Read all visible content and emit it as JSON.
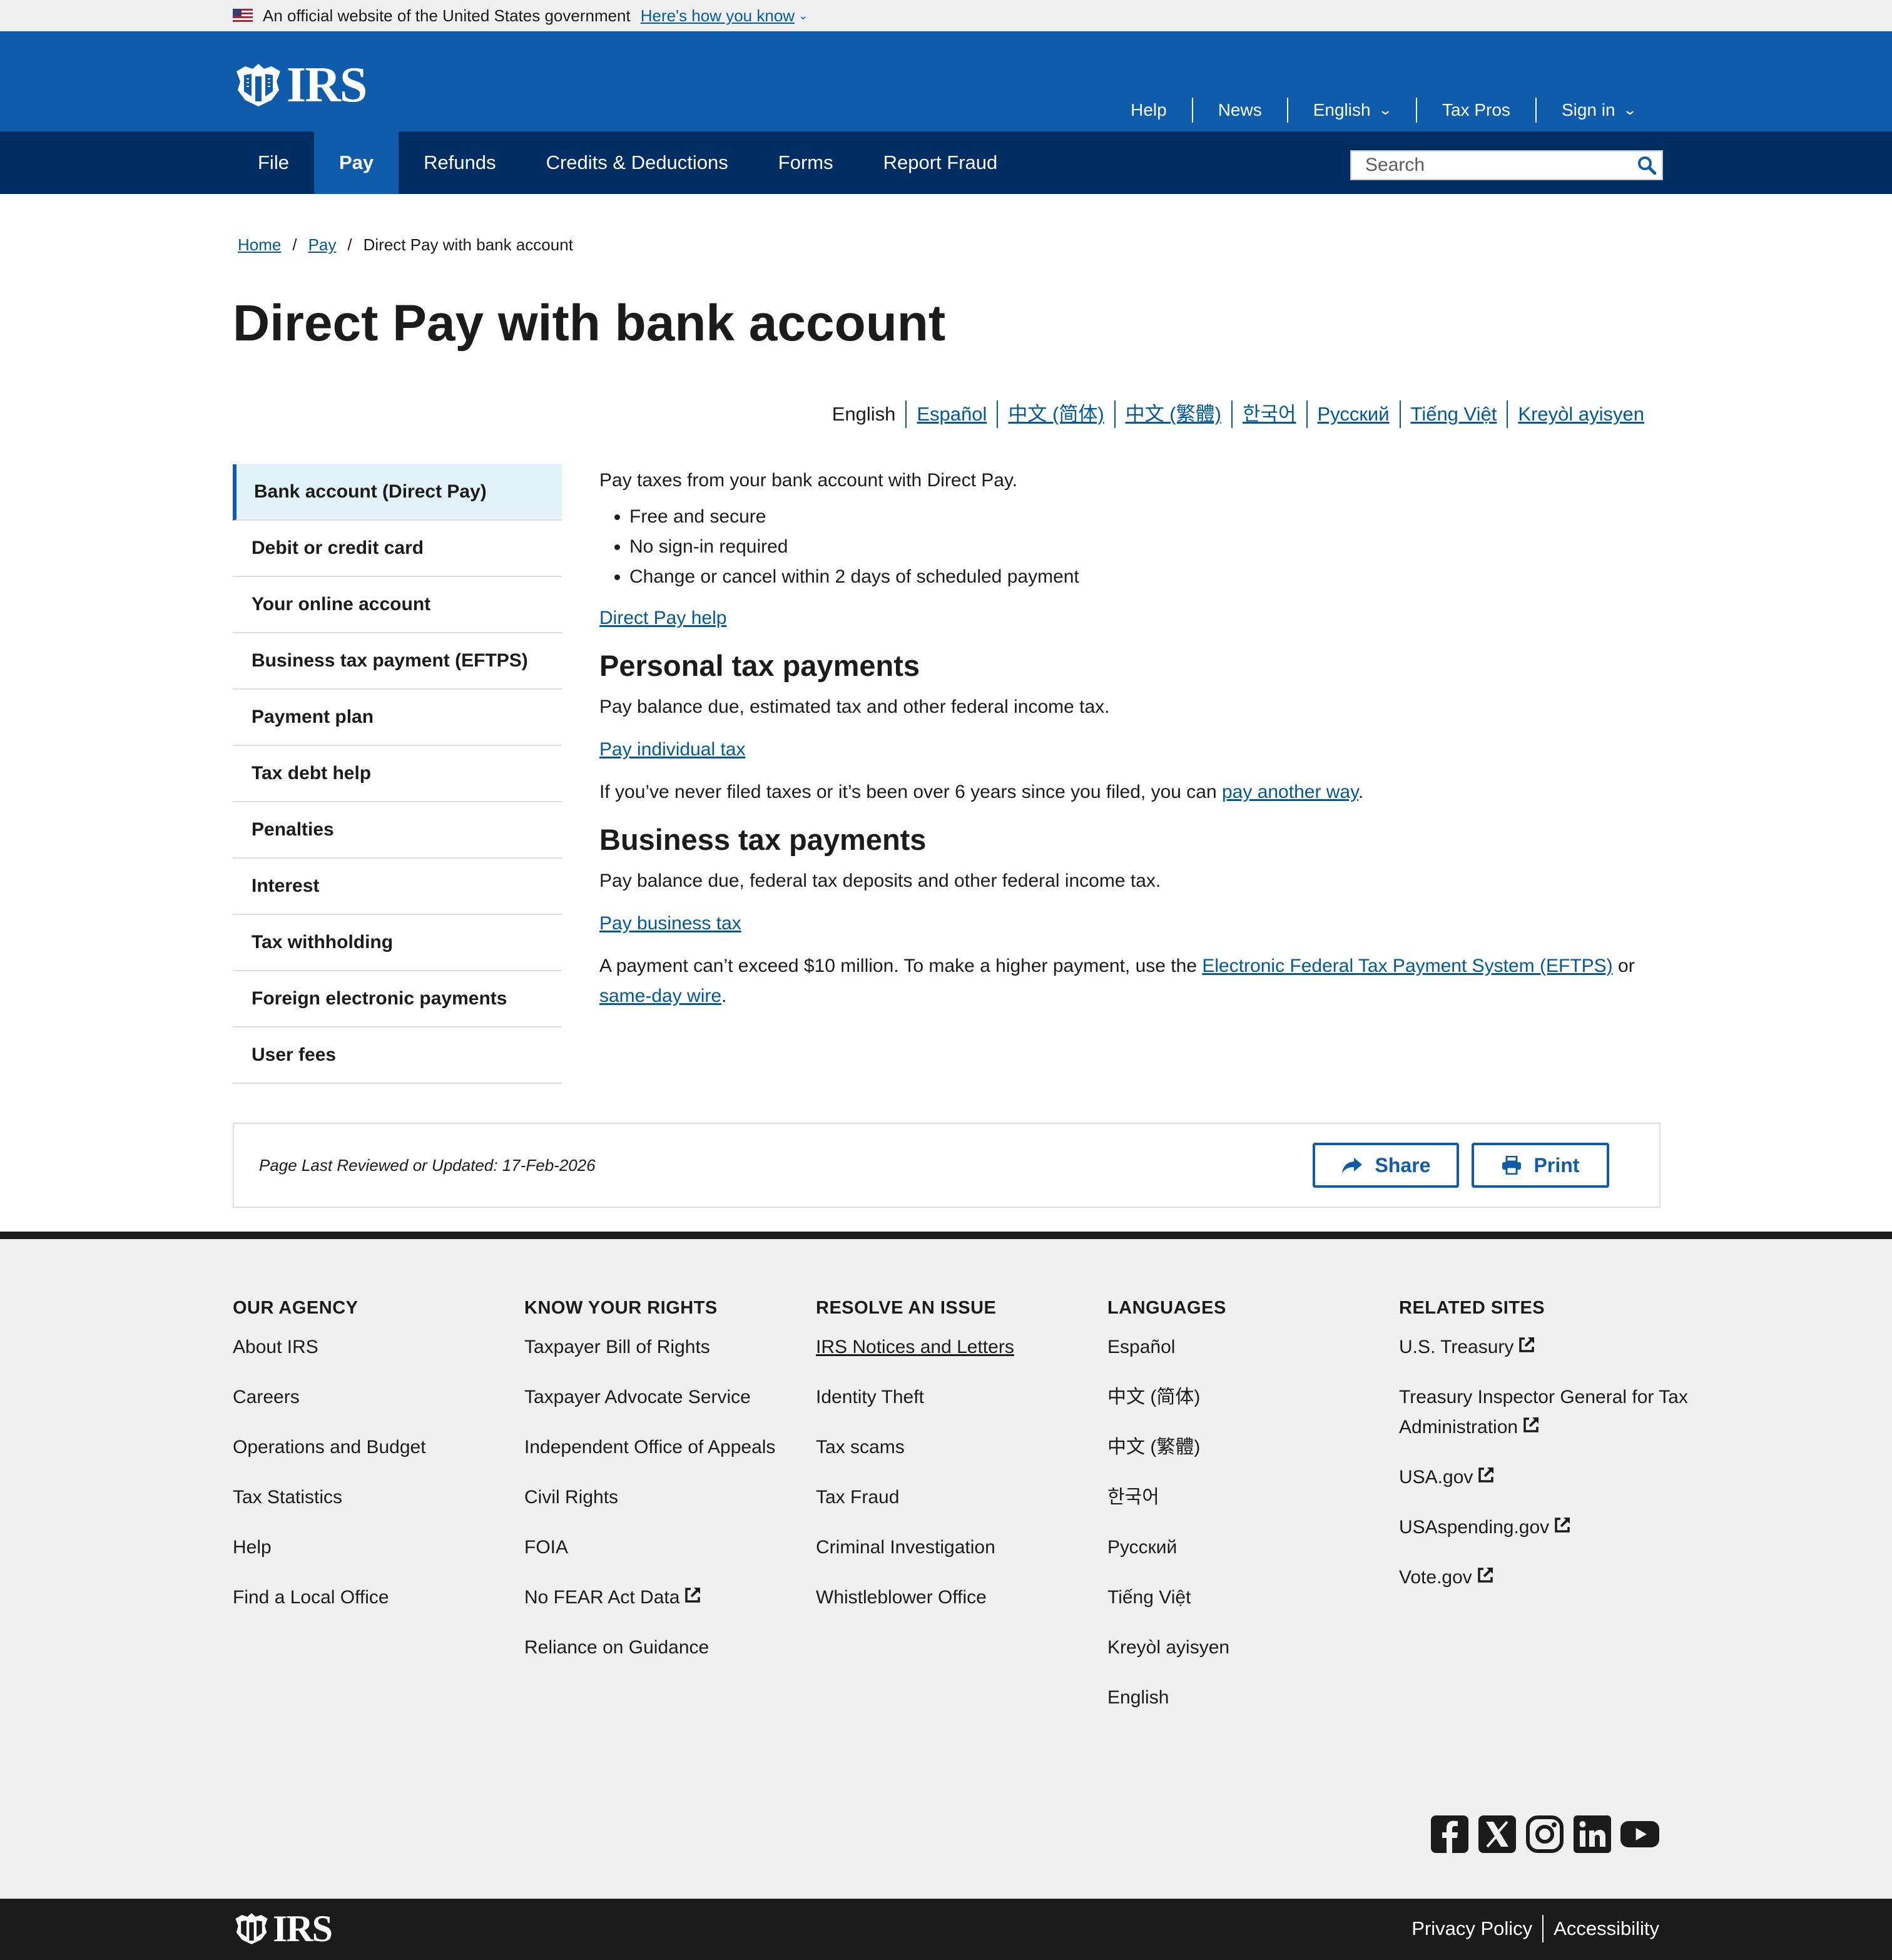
{
  "gov_banner": {
    "text": "An official website of the United States government",
    "how_link": "Here's how you know"
  },
  "header": {
    "logo_text": "IRS",
    "utility_nav": [
      {
        "label": "Help",
        "has_caret": false
      },
      {
        "label": "News",
        "has_caret": false
      },
      {
        "label": "English",
        "has_caret": true
      },
      {
        "label": "Tax Pros",
        "has_caret": false
      },
      {
        "label": "Sign in",
        "has_caret": true
      }
    ]
  },
  "main_nav": {
    "items": [
      "File",
      "Pay",
      "Refunds",
      "Credits & Deductions",
      "Forms",
      "Report Fraud"
    ],
    "active": "Pay",
    "search_placeholder": "Search"
  },
  "breadcrumb": {
    "items": [
      "Home",
      "Pay",
      "Direct Pay with bank account"
    ],
    "separator": "/"
  },
  "page_title": "Direct Pay with bank account",
  "language_switcher": {
    "current": "English",
    "links": [
      "Español",
      "中文 (简体)",
      "中文 (繁體)",
      "한국어",
      "Русский",
      "Tiếng Việt",
      "Kreyòl ayisyen"
    ]
  },
  "sidenav": {
    "active": "Bank account (Direct Pay)",
    "items": [
      "Bank account (Direct Pay)",
      "Debit or credit card",
      "Your online account",
      "Business tax payment (EFTPS)",
      "Payment plan",
      "Tax debt help",
      "Penalties",
      "Interest",
      "Tax withholding",
      "Foreign electronic payments",
      "User fees"
    ]
  },
  "content": {
    "intro": "Pay taxes from your bank account with Direct Pay.",
    "bullets": [
      "Free and secure",
      "No sign-in required",
      "Change or cancel within 2 days of scheduled payment"
    ],
    "help_link": "Direct Pay help",
    "personal": {
      "heading": "Personal tax payments",
      "desc": "Pay balance due, estimated tax and other federal income tax.",
      "link": "Pay individual tax",
      "note_pre": "If you’ve never filed taxes or it’s been over 6 years since you filed, you can ",
      "note_link": "pay another way",
      "note_post": "."
    },
    "business": {
      "heading": "Business tax payments",
      "desc": "Pay balance due, federal tax deposits and other federal income tax.",
      "link": "Pay business tax",
      "note_pre": "A payment can’t exceed $10 million. To make a higher payment, use the ",
      "note_link1": "Electronic Federal Tax Payment System (EFTPS)",
      "note_mid": " or ",
      "note_link2": "same-day wire",
      "note_post": "."
    }
  },
  "review": {
    "updated": "Page Last Reviewed or Updated: 17-Feb-2026",
    "share_label": "Share",
    "print_label": "Print"
  },
  "footer": {
    "columns": [
      {
        "heading": "OUR AGENCY",
        "links": [
          {
            "label": "About IRS"
          },
          {
            "label": "Careers"
          },
          {
            "label": "Operations and Budget"
          },
          {
            "label": "Tax Statistics"
          },
          {
            "label": "Help"
          },
          {
            "label": "Find a Local Office"
          }
        ]
      },
      {
        "heading": "KNOW YOUR RIGHTS",
        "links": [
          {
            "label": "Taxpayer Bill of Rights"
          },
          {
            "label": "Taxpayer Advocate Service"
          },
          {
            "label": "Independent Office of Appeals"
          },
          {
            "label": "Civil Rights"
          },
          {
            "label": "FOIA"
          },
          {
            "label": "No FEAR Act Data",
            "external": true
          },
          {
            "label": "Reliance on Guidance"
          }
        ]
      },
      {
        "heading": "RESOLVE AN ISSUE",
        "links": [
          {
            "label": "IRS Notices and Letters",
            "underline": true
          },
          {
            "label": "Identity Theft"
          },
          {
            "label": "Tax scams"
          },
          {
            "label": "Tax Fraud"
          },
          {
            "label": "Criminal Investigation"
          },
          {
            "label": "Whistleblower Office"
          }
        ]
      },
      {
        "heading": "LANGUAGES",
        "links": [
          {
            "label": "Español"
          },
          {
            "label": "中文 (简体)"
          },
          {
            "label": "中文 (繁體)"
          },
          {
            "label": "한국어"
          },
          {
            "label": "Русский"
          },
          {
            "label": "Tiếng Việt"
          },
          {
            "label": "Kreyòl ayisyen"
          },
          {
            "label": "English"
          }
        ]
      },
      {
        "heading": "RELATED SITES",
        "links": [
          {
            "label": "U.S. Treasury",
            "external": true
          },
          {
            "label": "Treasury Inspector General for Tax Administration",
            "external": true
          },
          {
            "label": "USA.gov",
            "external": true
          },
          {
            "label": "USAspending.gov",
            "external": true
          },
          {
            "label": "Vote.gov",
            "external": true
          }
        ]
      }
    ],
    "social": [
      "facebook-icon",
      "x-icon",
      "instagram-icon",
      "linkedin-icon",
      "youtube-icon"
    ],
    "bottom_links": [
      "Privacy Policy",
      "Accessibility"
    ]
  },
  "colors": {
    "header_blue": "#0e5cab",
    "nav_navy": "#002d62",
    "link_blue": "#00599c",
    "active_side_bg": "#e1f3f8"
  }
}
